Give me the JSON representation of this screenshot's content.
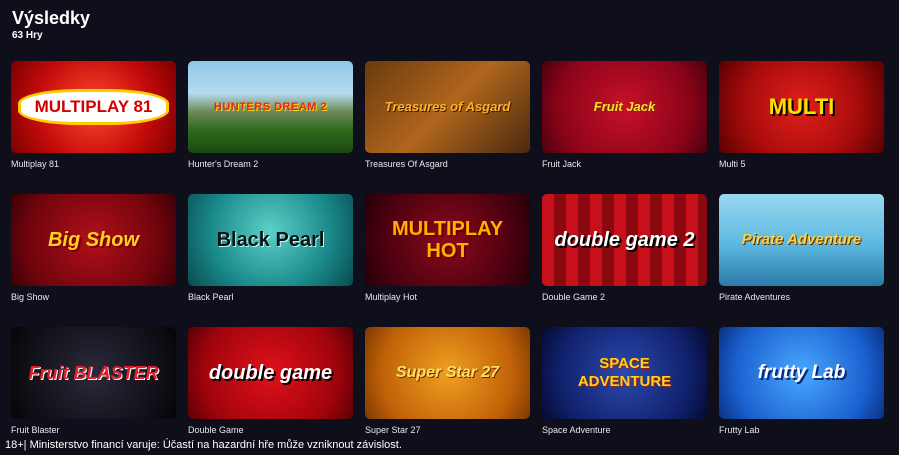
{
  "header": {
    "title": "Výsledky",
    "count": "63 Hry"
  },
  "games": [
    {
      "name": "Multiplay 81",
      "logo": "MULTIPLAY 81",
      "theme": "t-multiplay81"
    },
    {
      "name": "Hunter's Dream 2",
      "logo": "HUNTERS DREAM 2",
      "theme": "t-hunters"
    },
    {
      "name": "Treasures Of Asgard",
      "logo": "Treasures of Asgard",
      "theme": "t-asgard"
    },
    {
      "name": "Fruit Jack",
      "logo": "Fruit Jack",
      "theme": "t-fruitjack"
    },
    {
      "name": "Multi 5",
      "logo": "MULTI",
      "theme": "t-multi5"
    },
    {
      "name": "Big Show",
      "logo": "Big Show",
      "theme": "t-bigshow"
    },
    {
      "name": "Black Pearl",
      "logo": "Black Pearl",
      "theme": "t-blackpearl"
    },
    {
      "name": "Multiplay Hot",
      "logo": "MULTIPLAY HOT",
      "theme": "t-multiplayhot"
    },
    {
      "name": "Double Game 2",
      "logo": "double game 2",
      "theme": "t-doublegame2"
    },
    {
      "name": "Pirate Adventures",
      "logo": "Pirate Adventure",
      "theme": "t-pirate"
    },
    {
      "name": "Fruit Blaster",
      "logo": "Fruit BLASTER",
      "theme": "t-fruitblaster"
    },
    {
      "name": "Double Game",
      "logo": "double game",
      "theme": "t-doublegame"
    },
    {
      "name": "Super Star 27",
      "logo": "Super Star 27",
      "theme": "t-superstar"
    },
    {
      "name": "Space Adventure",
      "logo": "SPACE ADVENTURE",
      "theme": "t-space"
    },
    {
      "name": "Frutty Lab",
      "logo": "frutty Lab",
      "theme": "t-fruttylab"
    }
  ],
  "footer": {
    "disclaimer": "18+| Ministerstvo financí varuje: Účastí na hazardní hře může vzniknout závislost."
  }
}
